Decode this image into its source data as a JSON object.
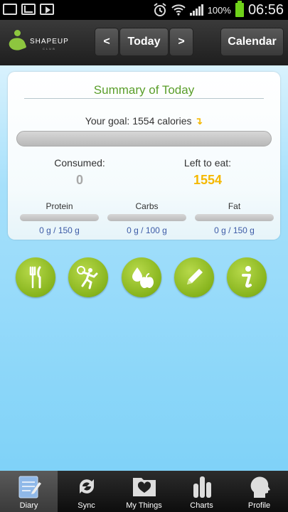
{
  "status_bar": {
    "battery_percent": "100%",
    "time": "06:56",
    "icons": [
      "gallery-icon",
      "mail-icon",
      "play-store-icon",
      "alarm-icon",
      "wifi-icon",
      "signal-icon",
      "battery-icon"
    ]
  },
  "header": {
    "logo_text": "SHAPEUP",
    "logo_sub": "CLUB",
    "prev_label": "<",
    "today_label": "Today",
    "next_label": ">",
    "calendar_label": "Calendar"
  },
  "summary": {
    "title": "Summary of Today",
    "goal_text": "Your goal: 1554 calories",
    "goal_progress": 0,
    "consumed_label": "Consumed:",
    "consumed_value": "0",
    "left_label": "Left to eat:",
    "left_value": "1554",
    "macros": [
      {
        "name": "Protein",
        "value": "0 g / 150 g",
        "progress": 0
      },
      {
        "name": "Carbs",
        "value": "0 g / 100 g",
        "progress": 0
      },
      {
        "name": "Fat",
        "value": "0 g / 150 g",
        "progress": 0
      }
    ]
  },
  "actions": [
    {
      "name": "food",
      "icon": "fork-knife-icon"
    },
    {
      "name": "exercise",
      "icon": "runner-icon"
    },
    {
      "name": "water-fruit",
      "icon": "water-apple-icon"
    },
    {
      "name": "note",
      "icon": "pencil-icon"
    },
    {
      "name": "info",
      "icon": "info-icon"
    }
  ],
  "tabs": [
    {
      "label": "Diary",
      "icon": "diary-icon",
      "active": true
    },
    {
      "label": "Sync",
      "icon": "sync-icon",
      "active": false
    },
    {
      "label": "My Things",
      "icon": "heart-folder-icon",
      "active": false
    },
    {
      "label": "Charts",
      "icon": "bar-chart-icon",
      "active": false
    },
    {
      "label": "Profile",
      "icon": "profile-head-icon",
      "active": false
    }
  ],
  "colors": {
    "accent_green": "#8dc63f",
    "title_green": "#5a9e2a",
    "left_to_eat": "#f5b800",
    "macro_value": "#3c5aa6",
    "background_blue": "#7fd2f8"
  }
}
